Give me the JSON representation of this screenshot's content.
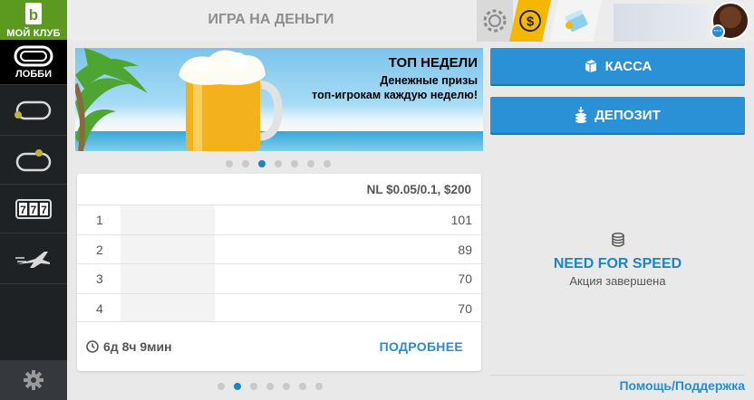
{
  "sidebar": {
    "club_label": "МОЙ КЛУБ",
    "lobby_label": "ЛОББИ",
    "items": [
      {
        "icon": "cash-table-icon"
      },
      {
        "icon": "tournament-table-icon"
      },
      {
        "icon": "slots-777-icon"
      },
      {
        "icon": "spin-plane-icon"
      }
    ],
    "settings_icon": "gear-icon"
  },
  "header": {
    "title": "ИГРА НА ДЕНЬГИ",
    "chips_icon": "poker-chip-icon",
    "coin_icon": "dollar-coin-icon",
    "tickets_icon": "tickets-icon"
  },
  "banner": {
    "title": "ТОП НЕДЕЛИ",
    "line1": "Денежные призы",
    "line2": "топ-игрокам каждую неделю!"
  },
  "carousel_top": {
    "count": 7,
    "active": 2
  },
  "leaderboard": {
    "stakes": "NL $0.05/0.1, $200",
    "rows": [
      {
        "rank": "1",
        "score": "101"
      },
      {
        "rank": "2",
        "score": "89"
      },
      {
        "rank": "3",
        "score": "70"
      },
      {
        "rank": "4",
        "score": "70"
      }
    ],
    "timer": "6д 8ч 9мин",
    "more_label": "ПОДРОБНЕЕ"
  },
  "carousel_bottom": {
    "count": 7,
    "active": 1
  },
  "actions": {
    "kassa_label": "КАССА",
    "deposit_label": "ДЕПОЗИТ"
  },
  "promo": {
    "name": "NEED FOR SPEED",
    "status": "Акция завершена"
  },
  "footer": {
    "help_label": "Помощь/Поддержка"
  },
  "colors": {
    "accent": "#2a91d6",
    "club_green": "#5b9a1f",
    "coin": "#f5b700",
    "sidebar": "#1f2225"
  }
}
